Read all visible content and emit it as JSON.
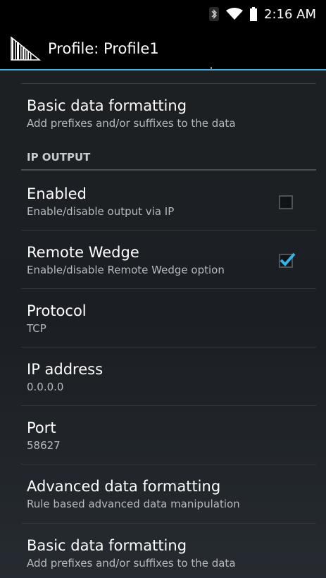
{
  "status_bar": {
    "time": "2:16 AM",
    "icons": [
      "bluetooth-icon",
      "wifi-icon",
      "battery-icon"
    ]
  },
  "action_bar": {
    "title": "Profile: Profile1",
    "logo": "barcode-logo-icon"
  },
  "colors": {
    "accent": "#33b5e5",
    "check": "#33b5e5"
  },
  "preferences": {
    "basic_top": {
      "title": "Basic data formatting",
      "summary": "Add prefixes and/or suffixes to the data"
    },
    "category_ip_output": "IP OUTPUT",
    "enabled": {
      "title": "Enabled",
      "summary": "Enable/disable output via IP",
      "checked": false
    },
    "remote_wedge": {
      "title": "Remote Wedge",
      "summary": "Enable/disable Remote Wedge option",
      "checked": true
    },
    "protocol": {
      "title": "Protocol",
      "summary": "TCP"
    },
    "ip_address": {
      "title": "IP address",
      "summary": "0.0.0.0"
    },
    "port": {
      "title": "Port",
      "summary": "58627"
    },
    "advanced": {
      "title": "Advanced data formatting",
      "summary": "Rule based advanced data manipulation"
    },
    "basic_bottom": {
      "title": "Basic data formatting",
      "summary": "Add prefixes and/or suffixes to the data"
    }
  }
}
